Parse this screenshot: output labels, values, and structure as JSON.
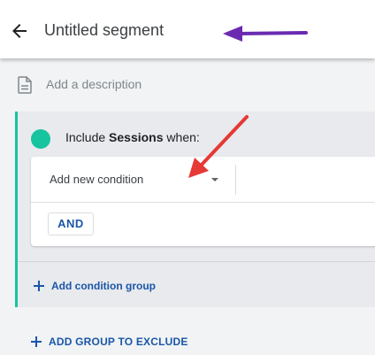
{
  "header": {
    "title": "Untitled segment",
    "back_icon": "arrow-back-icon"
  },
  "description": {
    "placeholder": "Add a description",
    "icon": "document-icon"
  },
  "condition_group": {
    "include_prefix": "Include",
    "include_entity": "Sessions",
    "include_suffix": "when:",
    "condition_placeholder": "Add new condition",
    "and_label": "AND",
    "add_group_label": "Add condition group"
  },
  "exclude": {
    "label": "ADD GROUP TO EXCLUDE"
  },
  "colors": {
    "accent_teal": "#16c4a0",
    "link_blue": "#1a56a8",
    "annotation_purple": "#6a2bb0",
    "annotation_red": "#e53935"
  }
}
